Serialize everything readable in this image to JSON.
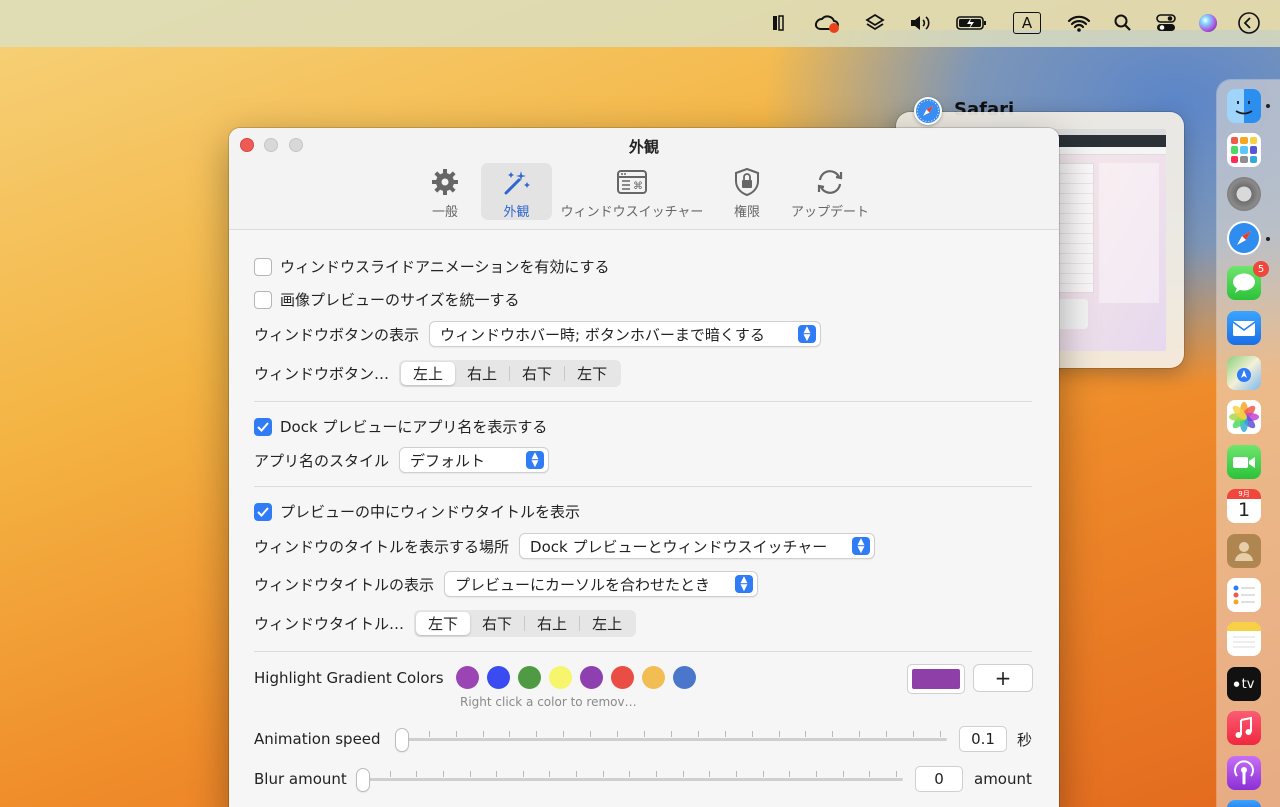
{
  "menubar": {
    "icons": [
      "app-extra-icon",
      "creative-cloud-icon",
      "layers-icon",
      "volume-icon",
      "battery-icon",
      "input-a-icon",
      "wifi-icon",
      "search-icon",
      "control-center-icon",
      "siri-icon",
      "clock-icon"
    ],
    "input_label": "A"
  },
  "window": {
    "title": "外観"
  },
  "tabs": [
    {
      "label": "一般",
      "icon": "gear-icon"
    },
    {
      "label": "外観",
      "icon": "magic-wand-icon"
    },
    {
      "label": "ウィンドウスイッチャー",
      "icon": "window-switcher-icon"
    },
    {
      "label": "権限",
      "icon": "lock-shield-icon"
    },
    {
      "label": "アップデート",
      "icon": "refresh-icon"
    }
  ],
  "settings": {
    "slide_animation": {
      "label": "ウィンドウスライドアニメーションを有効にする",
      "checked": false
    },
    "uniform_preview": {
      "label": "画像プレビューのサイズを統一する",
      "checked": false
    },
    "button_display": {
      "label": "ウィンドウボタンの表示",
      "value": "ウィンドウホバー時; ボタンホバーまで暗くする"
    },
    "button_position": {
      "label": "ウィンドウボタン…",
      "options": [
        "左上",
        "右上",
        "右下",
        "左下"
      ],
      "selected": "左上"
    },
    "show_app_name": {
      "label": "Dock プレビューにアプリ名を表示する",
      "checked": true
    },
    "app_name_style": {
      "label": "アプリ名のスタイル",
      "value": "デフォルト"
    },
    "show_window_title": {
      "label": "プレビューの中にウィンドウタイトルを表示",
      "checked": true
    },
    "title_location": {
      "label": "ウィンドウのタイトルを表示する場所",
      "value": "Dock プレビューとウィンドウスイッチャー"
    },
    "title_display": {
      "label": "ウィンドウタイトルの表示",
      "value": "プレビューにカーソルを合わせたとき"
    },
    "title_position": {
      "label": "ウィンドウタイトル…",
      "options": [
        "左下",
        "右下",
        "右上",
        "左上"
      ],
      "selected": "左下"
    },
    "gradient": {
      "label": "Highlight Gradient Colors",
      "hint": "Right click a color to remov…",
      "colors": [
        "#9b45b5",
        "#3b4bf2",
        "#4f9a43",
        "#f7f56b",
        "#8e3fb0",
        "#e94d44",
        "#f2bd52",
        "#4a76cc"
      ],
      "selected_color": "#8e3fa8",
      "add_label": "+"
    },
    "animation_speed": {
      "label": "Animation speed",
      "value": "0.1",
      "unit": "秒",
      "fraction": 0.0
    },
    "blur_amount": {
      "label": "Blur amount",
      "value": "0",
      "unit": "amount",
      "fraction": 0.0
    }
  },
  "preview": {
    "app_name": "Safari"
  },
  "dock": {
    "apps": [
      "finder-icon",
      "launchpad-icon",
      "system-settings-icon",
      "safari-icon",
      "messages-icon",
      "mail-icon",
      "maps-icon",
      "photos-icon",
      "facetime-icon",
      "calendar-icon",
      "contacts-icon",
      "reminders-icon",
      "notes-icon",
      "apple-tv-icon",
      "music-icon",
      "podcasts-icon"
    ],
    "messages_badge": "5",
    "calendar_month": "9月",
    "calendar_day": "1",
    "tv_label": "tv"
  }
}
